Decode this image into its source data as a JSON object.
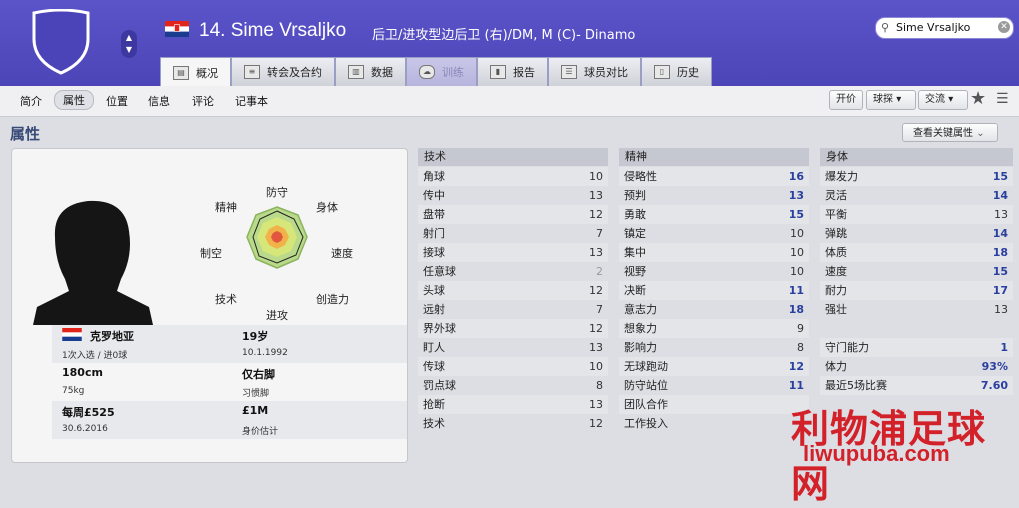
{
  "header": {
    "player_name": "14. Sime Vrsaljko",
    "position_text": "后卫/进攻型边后卫 (右)/DM, M (C)- Dinamo",
    "search_value": "Sime Vrsaljko",
    "flag_colors": [
      "#e2231a",
      "#ffffff",
      "#1a3c8f"
    ],
    "bg_color": "#5048c0"
  },
  "tabs": [
    {
      "label": "概况",
      "icon": "profile-icon"
    },
    {
      "label": "转会及合约",
      "icon": "contract-icon"
    },
    {
      "label": "数据",
      "icon": "stats-icon"
    },
    {
      "label": "训练",
      "icon": "training-icon"
    },
    {
      "label": "报告",
      "icon": "report-icon"
    },
    {
      "label": "球员对比",
      "icon": "compare-icon"
    },
    {
      "label": "历史",
      "icon": "history-icon"
    }
  ],
  "subnav": {
    "items": [
      "简介",
      "属性",
      "位置",
      "信息",
      "评论",
      "记事本"
    ],
    "offer": "开价",
    "player_menu": "球探",
    "exchange_menu": "交流"
  },
  "page_title": "属性",
  "key_attr_button": "查看关键属性",
  "radar": {
    "labels": [
      "防守",
      "身体",
      "速度",
      "创造力",
      "进攻",
      "技术",
      "制空",
      "精神"
    ]
  },
  "info": {
    "nation": "克罗地亚",
    "caps": "1次入选 / 进0球",
    "age": "19岁",
    "dob": "10.1.1992",
    "height": "180cm",
    "weight": "75kg",
    "foot": "仅右脚",
    "foot_label": "习惯脚",
    "wage": "每周£525",
    "contract": "30.6.2016",
    "value": "£1M",
    "value_label": "身价估计"
  },
  "technical": {
    "title": "技术",
    "rows": [
      {
        "name": "角球",
        "value": "10"
      },
      {
        "name": "传中",
        "value": "13"
      },
      {
        "name": "盘带",
        "value": "12"
      },
      {
        "name": "射门",
        "value": "7"
      },
      {
        "name": "接球",
        "value": "13"
      },
      {
        "name": "任意球",
        "value": "2"
      },
      {
        "name": "头球",
        "value": "12"
      },
      {
        "name": "远射",
        "value": "7"
      },
      {
        "name": "界外球",
        "value": "12"
      },
      {
        "name": "盯人",
        "value": "13"
      },
      {
        "name": "传球",
        "value": "10"
      },
      {
        "name": "罚点球",
        "value": "8"
      },
      {
        "name": "抢断",
        "value": "13"
      },
      {
        "name": "技术",
        "value": "12"
      }
    ]
  },
  "mental": {
    "title": "精神",
    "rows": [
      {
        "name": "侵略性",
        "value": "16"
      },
      {
        "name": "预判",
        "value": "13"
      },
      {
        "name": "勇敢",
        "value": "15"
      },
      {
        "name": "镇定",
        "value": "10"
      },
      {
        "name": "集中",
        "value": "10"
      },
      {
        "name": "视野",
        "value": "10"
      },
      {
        "name": "决断",
        "value": "11"
      },
      {
        "name": "意志力",
        "value": "18"
      },
      {
        "name": "想象力",
        "value": "9"
      },
      {
        "name": "影响力",
        "value": "8"
      },
      {
        "name": "无球跑动",
        "value": "12"
      },
      {
        "name": "防守站位",
        "value": "11"
      },
      {
        "name": "团队合作",
        "value": ""
      },
      {
        "name": "工作投入",
        "value": ""
      }
    ]
  },
  "physical": {
    "title": "身体",
    "rows": [
      {
        "name": "爆发力",
        "value": "15"
      },
      {
        "name": "灵活",
        "value": "14"
      },
      {
        "name": "平衡",
        "value": "13"
      },
      {
        "name": "弹跳",
        "value": "14"
      },
      {
        "name": "体质",
        "value": "18"
      },
      {
        "name": "速度",
        "value": "15"
      },
      {
        "name": "耐力",
        "value": "17"
      },
      {
        "name": "强壮",
        "value": "13"
      }
    ],
    "extra": [
      {
        "name": "守门能力",
        "value": "1"
      },
      {
        "name": "体力",
        "value": "93%"
      },
      {
        "name": "最近5场比赛",
        "value": "7.60"
      }
    ]
  },
  "watermark": {
    "text": "利物浦足球网",
    "url": "liwupuba.com",
    "color": "#d3212a"
  }
}
